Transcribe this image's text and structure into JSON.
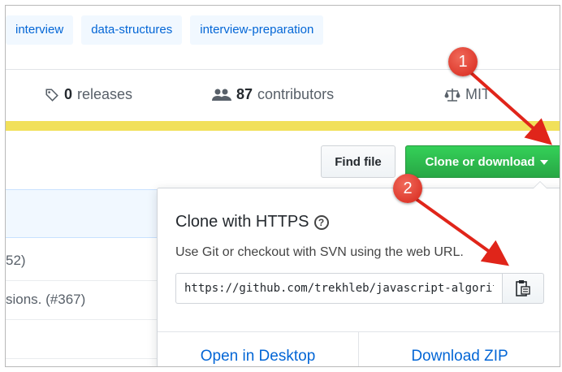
{
  "topics": [
    "interview",
    "data-structures",
    "interview-preparation"
  ],
  "stats": {
    "releases_count": "0",
    "releases_label": "releases",
    "contributors_count": "87",
    "contributors_label": "contributors",
    "license_label": "MIT"
  },
  "toolbar": {
    "find_file": "Find file",
    "clone_download": "Clone or download"
  },
  "file_rows": [
    "52)",
    "sions. (#367)"
  ],
  "clone_panel": {
    "title": "Clone with HTTPS",
    "help": "?",
    "description": "Use Git or checkout with SVN using the web URL.",
    "url": "https://github.com/trekhleb/javascript-algorithms.git",
    "open_desktop": "Open in Desktop",
    "download_zip": "Download ZIP"
  },
  "annotations": {
    "step1": "1",
    "step2": "2",
    "color": "#e0251a"
  },
  "colors": {
    "accent_green": "#28a745",
    "link_blue": "#0366d6",
    "language_bar": "#f1e05a"
  }
}
